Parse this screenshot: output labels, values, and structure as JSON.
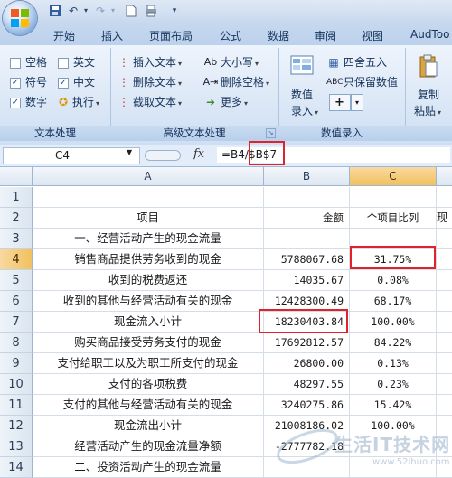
{
  "tabs": [
    "开始",
    "插入",
    "页面布局",
    "公式",
    "数据",
    "审阅",
    "视图",
    "AudToo"
  ],
  "ribbon": {
    "group1": {
      "label": "文本处理",
      "checkboxes": [
        "空格",
        "英文",
        "符号",
        "中文",
        "数字"
      ],
      "exec_label": "执行"
    },
    "group2": {
      "label": "高级文本处理",
      "insert_text": "插入文本",
      "delete_text": "删除文本",
      "extract_text": "截取文本",
      "case": "大小写",
      "delete_space": "删除空格",
      "more": "更多"
    },
    "group3": {
      "label": "数值录入",
      "value_entry_line1": "数值",
      "value_entry_line2": "录入",
      "round": "四舍五入",
      "keep_value": "只保留数值",
      "add_sign": "+"
    },
    "group4": {
      "copy_line1": "复制",
      "copy_line2": "粘贴"
    },
    "icons": [
      "office-logo",
      "save",
      "undo",
      "redo",
      "new-document",
      "print",
      "customize"
    ]
  },
  "formula_bar": {
    "name_box": "C4",
    "fx": "fx",
    "formula_prefix": "=B4/",
    "formula_highlight": "$B$7"
  },
  "grid": {
    "columns": [
      "A",
      "B",
      "C"
    ],
    "active_column": "C",
    "active_row": "4",
    "rows": [
      {
        "num": "1",
        "a": "",
        "b": "",
        "c": "",
        "d": ""
      },
      {
        "num": "2",
        "a": "项目",
        "b": "金额",
        "c": "个项目比列",
        "d": "现"
      },
      {
        "num": "3",
        "a": "一、经营活动产生的现金流量",
        "b": "",
        "c": "",
        "d": ""
      },
      {
        "num": "4",
        "a": "销售商品提供劳务收到的现金",
        "b": "5788067.68",
        "c": "31.75%",
        "d": ""
      },
      {
        "num": "5",
        "a": "收到的税费返还",
        "b": "14035.67",
        "c": "0.08%",
        "d": ""
      },
      {
        "num": "6",
        "a": "收到的其他与经营活动有关的现金",
        "b": "12428300.49",
        "c": "68.17%",
        "d": ""
      },
      {
        "num": "7",
        "a": "现金流入小计",
        "b": "18230403.84",
        "c": "100.00%",
        "d": ""
      },
      {
        "num": "8",
        "a": "购买商品接受劳务支付的现金",
        "b": "17692812.57",
        "c": "84.22%",
        "d": ""
      },
      {
        "num": "9",
        "a": "支付给职工以及为职工所支付的现金",
        "b": "26800.00",
        "c": "0.13%",
        "d": ""
      },
      {
        "num": "10",
        "a": "支付的各项税费",
        "b": "48297.55",
        "c": "0.23%",
        "d": ""
      },
      {
        "num": "11",
        "a": "支付的其他与经营活动有关的现金",
        "b": "3240275.86",
        "c": "15.42%",
        "d": ""
      },
      {
        "num": "12",
        "a": "现金流出小计",
        "b": "21008186.02",
        "c": "100.00%",
        "d": ""
      },
      {
        "num": "13",
        "a": "经营活动产生的现金流量净额",
        "b": "-2777782.18",
        "c": "",
        "d": ""
      },
      {
        "num": "14",
        "a": "二、投资活动产生的现金流量",
        "b": "",
        "c": "",
        "d": ""
      }
    ]
  },
  "watermark": {
    "brand": "生活IT技术网",
    "domain": "www.52ihuo.com"
  },
  "colors": {
    "highlight": "#e0232a",
    "active_header": "#f1c15f"
  }
}
